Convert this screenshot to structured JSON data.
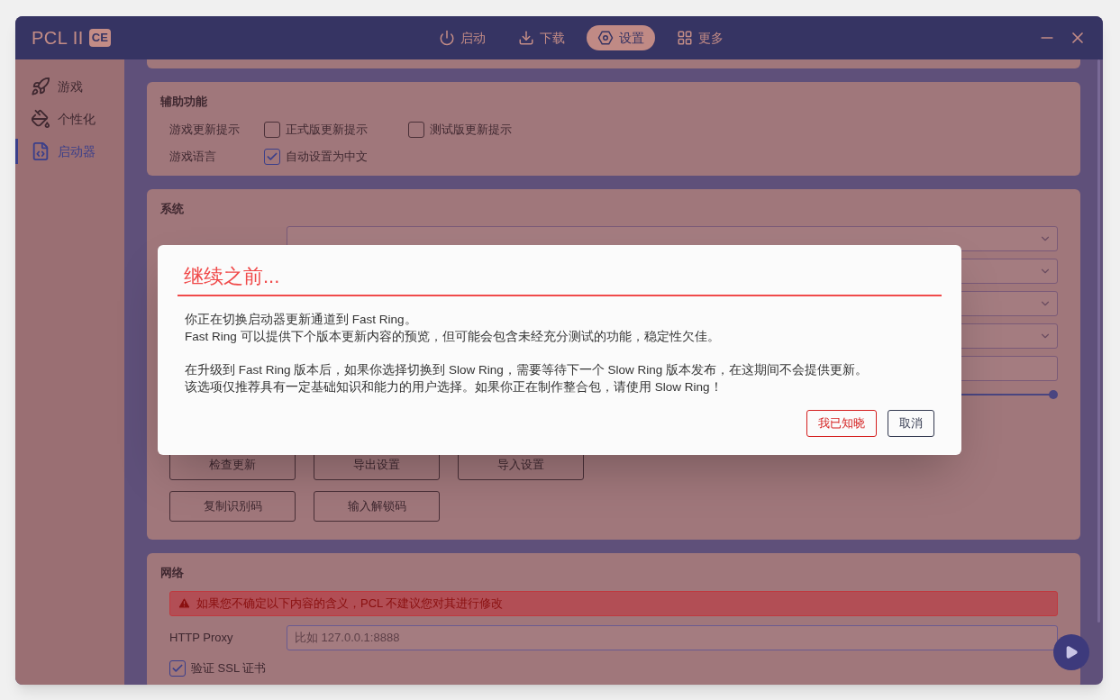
{
  "window": {
    "logo": "PCL II",
    "logo_badge": "CE"
  },
  "nav_tabs": [
    {
      "label": "启动",
      "selected": false
    },
    {
      "label": "下载",
      "selected": false
    },
    {
      "label": "设置",
      "selected": true
    },
    {
      "label": "更多",
      "selected": false
    }
  ],
  "sidebar": {
    "items": [
      {
        "label": "游戏",
        "selected": false
      },
      {
        "label": "个性化",
        "selected": false
      },
      {
        "label": "启动器",
        "selected": true
      }
    ]
  },
  "assist_section": {
    "title": "辅助功能",
    "rows": [
      {
        "label": "游戏更新提示",
        "options": [
          {
            "label": "正式版更新提示",
            "checked": false
          },
          {
            "label": "测试版更新提示",
            "checked": false
          }
        ]
      },
      {
        "label": "游戏语言",
        "options": [
          {
            "label": "自动设置为中文",
            "checked": true
          }
        ]
      }
    ]
  },
  "system_section": {
    "title": "系统",
    "controls": [
      {
        "kind": "dropdown"
      },
      {
        "kind": "dropdown"
      },
      {
        "kind": "dropdown"
      },
      {
        "kind": "dropdown"
      },
      {
        "kind": "text"
      },
      {
        "kind": "slider",
        "level": 1
      }
    ],
    "buttons": [
      [
        "检查更新",
        "导出设置",
        "导入设置"
      ],
      [
        "复制识别码",
        "输入解锁码"
      ]
    ]
  },
  "network_section": {
    "title": "网络",
    "warning": "如果您不确定以下内容的含义，PCL 不建议您对其进行修改",
    "proxy": {
      "label": "HTTP Proxy",
      "placeholder": "比如 127.0.0.1:8888"
    },
    "ssl": {
      "label": "验证 SSL 证书",
      "checked": true
    }
  },
  "dialog": {
    "title": "继续之前...",
    "paragraphs": [
      [
        "你正在切换启动器更新通道到 Fast Ring。",
        "Fast Ring 可以提供下个版本更新内容的预览，但可能会包含未经充分测试的功能，稳定性欠佳。"
      ],
      [
        "在升级到 Fast Ring 版本后，如果你选择切换到 Slow Ring，需要等待下一个 Slow Ring 版本发布，在这期间不会提供更新。",
        "该选项仅推荐具有一定基础知识和能力的用户选择。如果你正在制作整合包，请使用 Slow Ring！"
      ]
    ],
    "buttons": [
      {
        "label": "我已知晓",
        "kind": "primary"
      },
      {
        "label": "取消",
        "kind": "secondary"
      }
    ]
  }
}
